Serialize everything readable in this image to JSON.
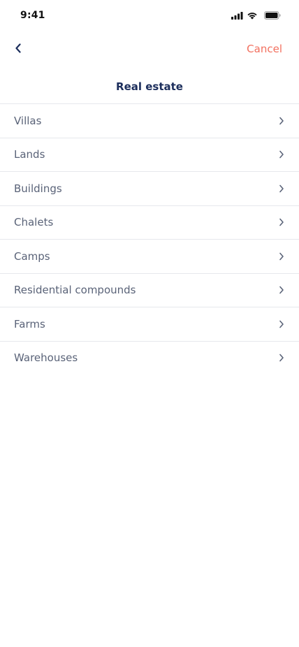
{
  "status_bar": {
    "time": "9:41"
  },
  "nav": {
    "back_icon": "chevron-left-icon",
    "cancel_label": "Cancel"
  },
  "header": {
    "title": "Real estate"
  },
  "categories": [
    {
      "label": "Villas"
    },
    {
      "label": "Lands"
    },
    {
      "label": "Buildings"
    },
    {
      "label": "Chalets"
    },
    {
      "label": "Camps"
    },
    {
      "label": "Residential compounds"
    },
    {
      "label": "Farms"
    },
    {
      "label": "Warehouses"
    }
  ],
  "colors": {
    "title": "#1c2e5c",
    "cancel": "#f2705f",
    "item_text": "#5a6378",
    "divider": "#e6e8ec",
    "back_chevron": "#1c2e5c"
  }
}
